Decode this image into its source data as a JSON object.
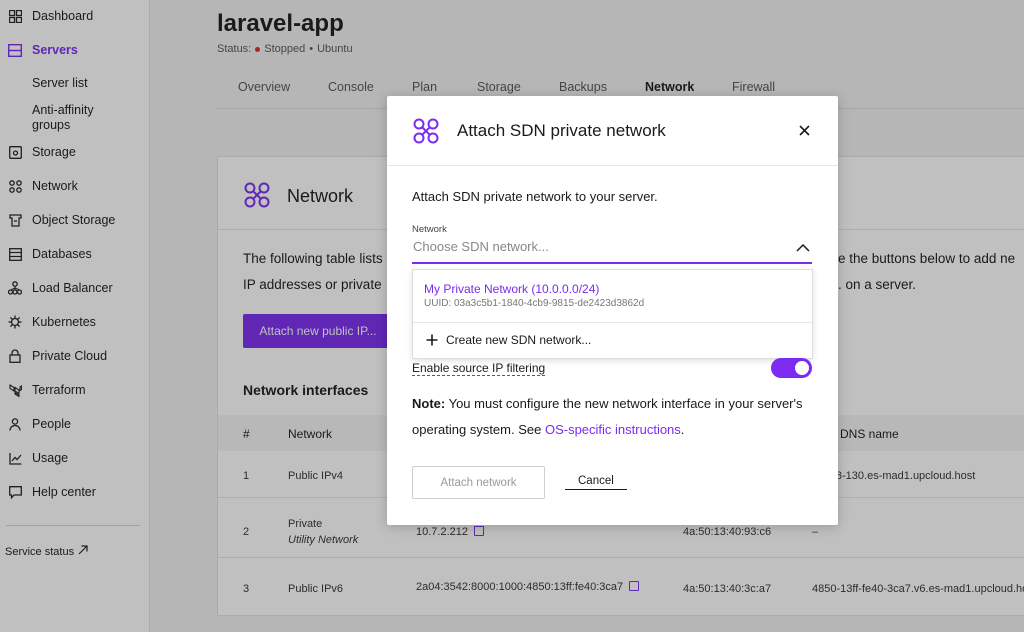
{
  "sidebar": {
    "items": [
      {
        "label": "Dashboard",
        "icon": "grid-icon"
      },
      {
        "label": "Servers",
        "icon": "server-icon",
        "active": true
      },
      {
        "label": "Storage",
        "icon": "disk-icon"
      },
      {
        "label": "Network",
        "icon": "network-icon"
      },
      {
        "label": "Object Storage",
        "icon": "bucket-icon"
      },
      {
        "label": "Databases",
        "icon": "database-icon"
      },
      {
        "label": "Load Balancer",
        "icon": "load-balancer-icon"
      },
      {
        "label": "Kubernetes",
        "icon": "kubernetes-icon"
      },
      {
        "label": "Private Cloud",
        "icon": "lock-icon"
      },
      {
        "label": "Terraform",
        "icon": "terraform-icon"
      },
      {
        "label": "People",
        "icon": "person-icon"
      },
      {
        "label": "Usage",
        "icon": "chart-icon"
      },
      {
        "label": "Help center",
        "icon": "chat-icon"
      }
    ],
    "sub_items": [
      "Server list",
      "Anti-affinity groups"
    ],
    "service_status": "Service status"
  },
  "server": {
    "title": "laravel-app",
    "status_prefix": "Status:",
    "status": "Stopped",
    "separator": "•",
    "os": "Ubuntu"
  },
  "tabs": [
    "Overview",
    "Console",
    "Plan",
    "Storage",
    "Backups",
    "Network",
    "Firewall"
  ],
  "active_tab": "Network",
  "network_card": {
    "title": "Network",
    "text_line1_left": "The following table lists",
    "text_line1_right": "e the buttons below to add ne",
    "text_line2_left": "IP addresses or private",
    "text_line2_right": ". on a server.",
    "attach_ip_button": "Attach new public IP..."
  },
  "interfaces": {
    "title": "Network interfaces",
    "columns": [
      "#",
      "Network",
      "rse DNS name"
    ],
    "rows": [
      {
        "num": "1",
        "network": "Public IPv4",
        "network_sub": "",
        "ip": "",
        "mac": "",
        "dns": "2-98-130.es-mad1.upcloud.host"
      },
      {
        "num": "2",
        "network": "Private",
        "network_sub": "Utility Network",
        "ip": "10.7.2.212",
        "mac": "4a:50:13:40:93:c6",
        "dns": "–"
      },
      {
        "num": "3",
        "network": "Public IPv6",
        "network_sub": "",
        "ip": "2a04:3542:8000:1000:4850:13ff:fe40:3ca7",
        "mac": "4a:50:13:40:3c:a7",
        "dns": "4850-13ff-fe40-3ca7.v6.es-mad1.upcloud.ho"
      }
    ]
  },
  "modal": {
    "title": "Attach SDN private network",
    "description": "Attach SDN private network to your server.",
    "field_label": "Network",
    "placeholder": "Choose SDN network...",
    "options": [
      {
        "name": "My Private Network (10.0.0.0/24)",
        "uuid": "UUID: 03a3c5b1-1840-4cb9-9815-de2423d3862d"
      }
    ],
    "create_label": "Create new SDN network...",
    "toggle_label": "Enable source IP filtering",
    "toggle_on": true,
    "note_bold": "Note:",
    "note_text": " You must configure the new network interface in your server's operating system. See ",
    "note_link": "OS-specific instructions",
    "note_end": ".",
    "attach_button": "Attach network",
    "cancel_button": "Cancel"
  },
  "colors": {
    "accent": "#7b2cf0",
    "status_stopped": "#e0262a"
  }
}
